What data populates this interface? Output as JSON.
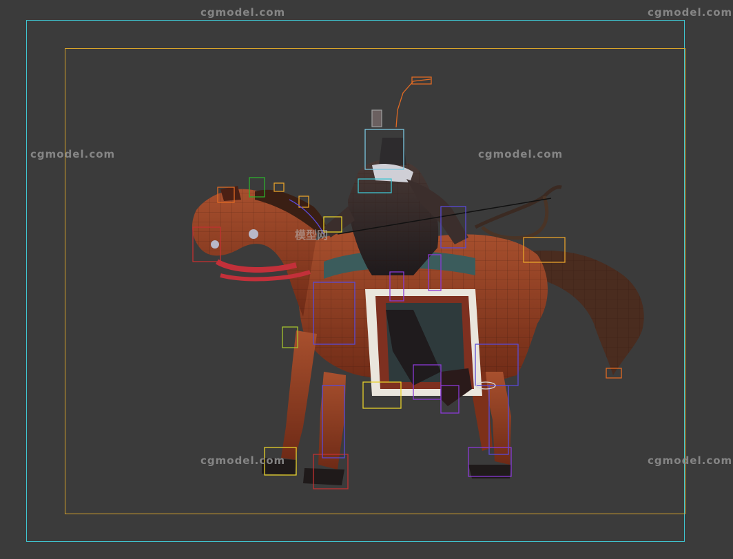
{
  "viewport": {
    "watermarks": [
      "cgmodel.com",
      "cgmodel.com",
      "cgmodel.com",
      "cgmodel.com",
      "cgmodel.com",
      "cgmodel.com"
    ],
    "center_watermark": "模型网",
    "safe_frame_colors": {
      "outer": "#3fc4cf",
      "inner": "#d9a52a"
    },
    "background": "#3b3b3b",
    "scene": "horse-archer rigged character model with bone gizmos"
  }
}
